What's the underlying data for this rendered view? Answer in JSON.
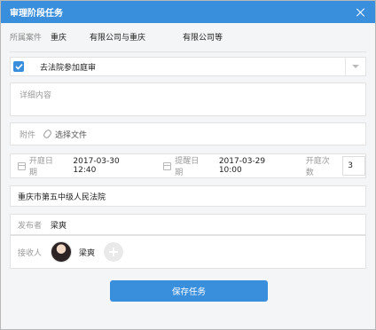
{
  "dialog": {
    "title": "审理阶段任务"
  },
  "case": {
    "label": "所属案件",
    "value": "重庆 有限公司与重庆 有限公司等",
    "parts": [
      "重庆",
      "有限公司与重庆",
      "有限公司等"
    ]
  },
  "task": {
    "checked": true,
    "title": "去法院参加庭审"
  },
  "details": {
    "placeholder": "详细内容"
  },
  "attachment": {
    "label": "附件",
    "link": "选择文件"
  },
  "schedule": {
    "start_label": "开庭日期",
    "start_value": "2017-03-30 12:40",
    "remind_label": "提醒日期",
    "remind_value": "2017-03-29 10:00",
    "count_label": "开庭次数",
    "count_value": "3"
  },
  "court": {
    "value": "重庆市第五中级人民法院"
  },
  "publisher": {
    "label": "发布者",
    "value": "梁爽"
  },
  "receiver": {
    "label": "接收人",
    "name": "梁爽"
  },
  "actions": {
    "save_label": "保存任务"
  },
  "colors": {
    "primary": "#3a8fdc"
  },
  "icons": [
    "close-icon",
    "check-icon",
    "chevron-down-icon",
    "paperclip-icon",
    "calendar-icon",
    "plus-icon"
  ]
}
